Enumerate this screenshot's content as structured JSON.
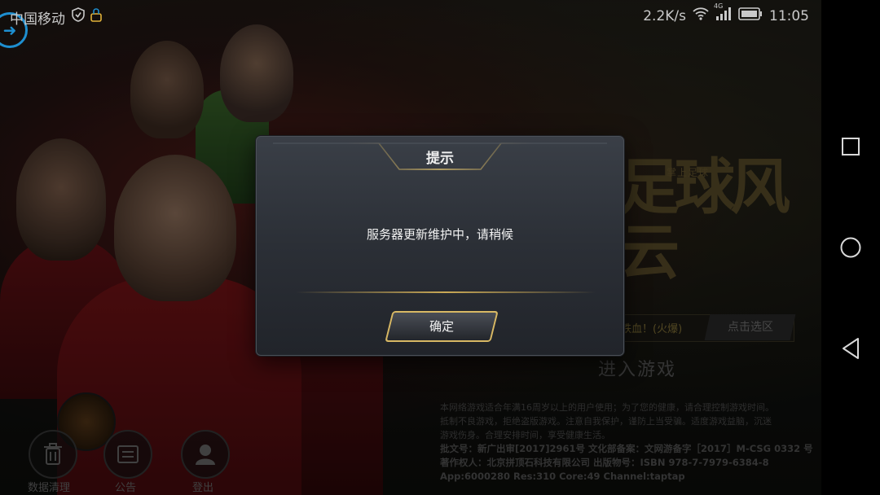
{
  "statusbar": {
    "carrier": "中国移动",
    "speed": "2.2K/s",
    "network": "4G",
    "time": "11:05"
  },
  "background": {
    "calligraphy_main": "足球风云",
    "calligraphy_small": "掌上足球",
    "server_name": "铁血！(火爆)",
    "server_select": "点击选区",
    "enter_game": "进入游戏",
    "legal_lines": [
      "本网络游戏适合年满16周岁以上的用户使用；为了您的健康，请合理控制游戏时间。",
      "抵制不良游戏，拒绝盗版游戏。注意自我保护，谨防上当受骗。适度游戏益脑，沉迷",
      "游戏伤身。合理安排时间，享受健康生活。",
      "批文号：新广出审[2017]2961号  文化部备案：文网游备字［2017］M-CSG 0332 号",
      "著作权人：北京拼顶石科技有限公司 出版物号：ISBN 978-7-7979-6384-8",
      "App:6000280 Res:310 Core:49 Channel:taptap"
    ],
    "buttons": [
      {
        "label": "数据清理",
        "icon": "trash-icon"
      },
      {
        "label": "公告",
        "icon": "notice-icon"
      },
      {
        "label": "登出",
        "icon": "user-icon"
      }
    ]
  },
  "dialog": {
    "title": "提示",
    "message": "服务器更新维护中，请稍候",
    "confirm_label": "确定"
  },
  "colors": {
    "accent_gold": "#d8b864",
    "side_arrow_blue": "#1e8fd0"
  }
}
